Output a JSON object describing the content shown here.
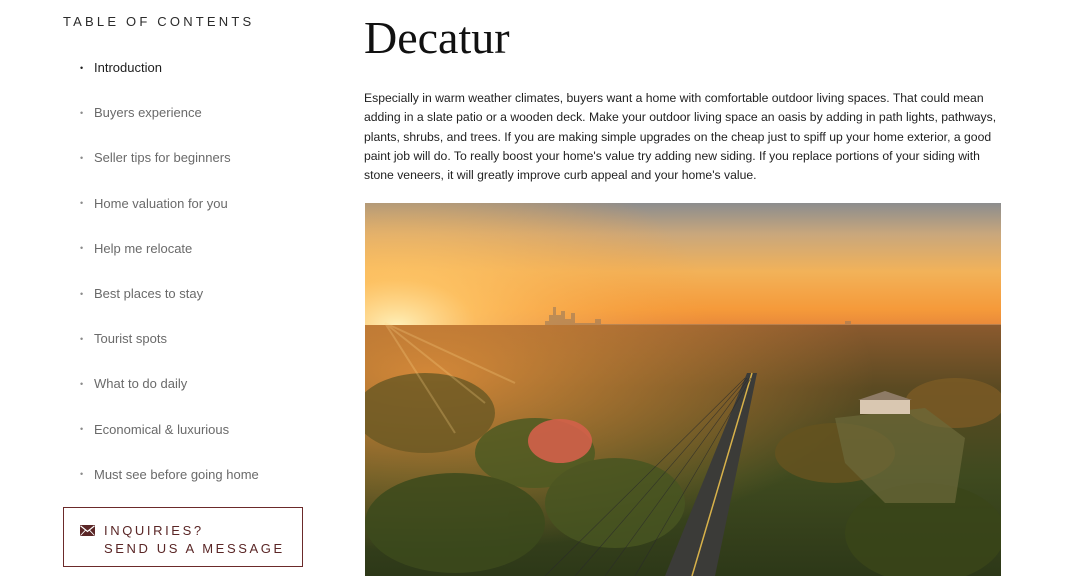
{
  "sidebar": {
    "toc_title": "TABLE OF CONTENTS",
    "items": [
      {
        "label": "Introduction",
        "active": true
      },
      {
        "label": "Buyers experience"
      },
      {
        "label": "Seller tips for beginners"
      },
      {
        "label": "Home valuation for you"
      },
      {
        "label": "Help me relocate"
      },
      {
        "label": "Best places to stay"
      },
      {
        "label": "Tourist spots"
      },
      {
        "label": "What to do daily"
      },
      {
        "label": "Economical & luxurious"
      },
      {
        "label": "Must see before going home"
      }
    ],
    "bullet": "•",
    "inquiry": {
      "line1": "INQUIRIES?",
      "line2": "SEND US A MESSAGE",
      "icon": "envelope-icon"
    }
  },
  "main": {
    "title": "Decatur",
    "body": "Especially in warm weather climates, buyers want a home with comfortable outdoor living spaces. That could mean adding in a slate patio or a wooden deck. Make your outdoor living space an oasis by adding in path lights, pathways, plants, shrubs, and trees. If you are making simple upgrades on the cheap just to spiff up your home exterior, a good paint job will do. To really boost your home's value try adding new siding. If you replace portions of your siding with stone veneers, it will greatly improve curb appeal and your home's value."
  },
  "colors": {
    "accent": "#6b2a2a",
    "text": "#2b2b2b",
    "muted": "#6a6a6a"
  }
}
